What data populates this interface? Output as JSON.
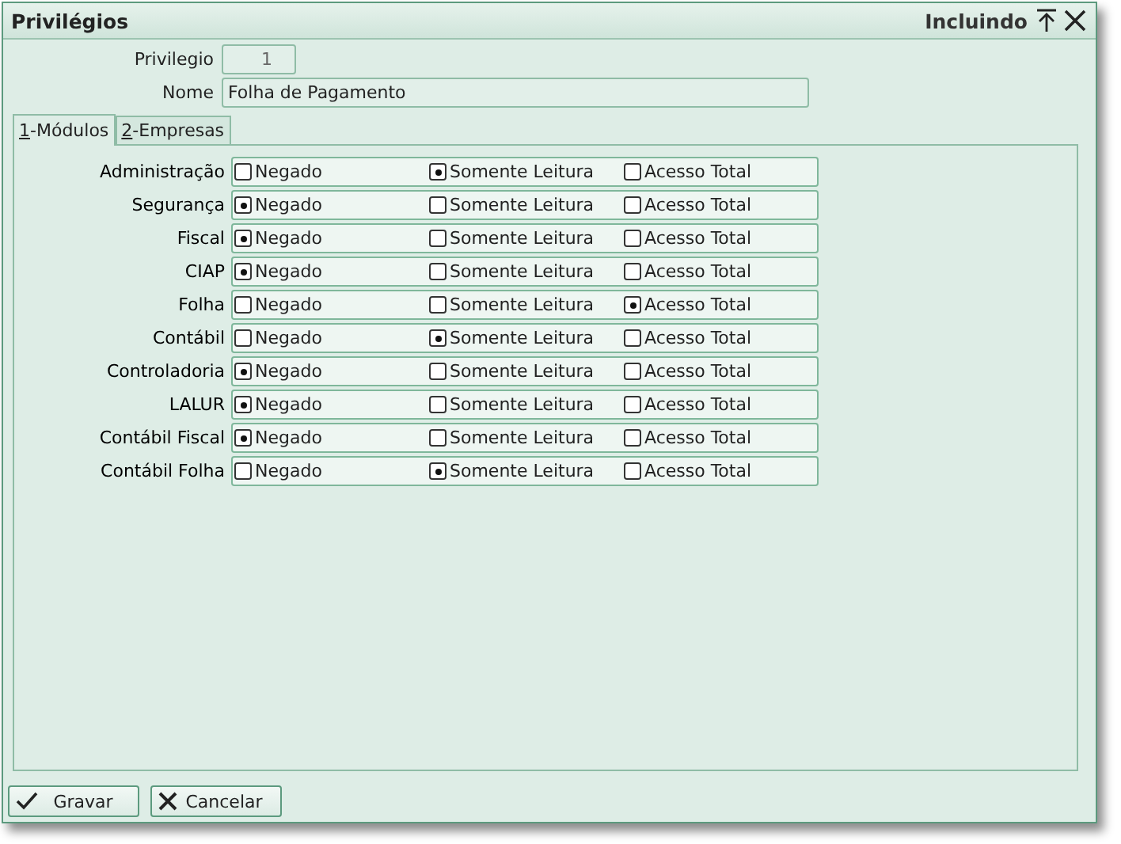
{
  "window": {
    "title": "Privilégios",
    "mode": "Incluindo"
  },
  "fields": [
    {
      "label": "Privilegio",
      "value": "1",
      "kind": "number"
    },
    {
      "label": "Nome",
      "value": "Folha de Pagamento",
      "kind": "text"
    }
  ],
  "tabs": [
    {
      "key": "1",
      "label": "-Módulos",
      "selected": true
    },
    {
      "key": "2",
      "label": "-Empresas",
      "selected": false
    }
  ],
  "modules": [
    {
      "name": "Administração",
      "options": [
        {
          "label": "Negado",
          "selected": false
        },
        {
          "label": "Somente Leitura",
          "selected": true
        },
        {
          "label": "Acesso Total",
          "selected": false
        }
      ]
    },
    {
      "name": "Segurança",
      "options": [
        {
          "label": "Negado",
          "selected": true
        },
        {
          "label": "Somente Leitura",
          "selected": false
        },
        {
          "label": "Acesso Total",
          "selected": false
        }
      ]
    },
    {
      "name": "Fiscal",
      "options": [
        {
          "label": "Negado",
          "selected": true
        },
        {
          "label": "Somente Leitura",
          "selected": false
        },
        {
          "label": "Acesso Total",
          "selected": false
        }
      ]
    },
    {
      "name": "CIAP",
      "options": [
        {
          "label": "Negado",
          "selected": true
        },
        {
          "label": "Somente Leitura",
          "selected": false
        },
        {
          "label": "Acesso Total",
          "selected": false
        }
      ]
    },
    {
      "name": "Folha",
      "options": [
        {
          "label": "Negado",
          "selected": false
        },
        {
          "label": "Somente Leitura",
          "selected": false
        },
        {
          "label": "Acesso Total",
          "selected": true
        }
      ]
    },
    {
      "name": "Contábil",
      "options": [
        {
          "label": "Negado",
          "selected": false
        },
        {
          "label": "Somente Leitura",
          "selected": true
        },
        {
          "label": "Acesso Total",
          "selected": false
        }
      ]
    },
    {
      "name": "Controladoria",
      "options": [
        {
          "label": "Negado",
          "selected": true
        },
        {
          "label": "Somente Leitura",
          "selected": false
        },
        {
          "label": "Acesso Total",
          "selected": false
        }
      ]
    },
    {
      "name": "LALUR",
      "options": [
        {
          "label": "Negado",
          "selected": true
        },
        {
          "label": "Somente Leitura",
          "selected": false
        },
        {
          "label": "Acesso Total",
          "selected": false
        }
      ]
    },
    {
      "name": "Contábil Fiscal",
      "options": [
        {
          "label": "Negado",
          "selected": true
        },
        {
          "label": "Somente Leitura",
          "selected": false
        },
        {
          "label": "Acesso Total",
          "selected": false
        }
      ]
    },
    {
      "name": "Contábil Folha",
      "options": [
        {
          "label": "Negado",
          "selected": false
        },
        {
          "label": "Somente Leitura",
          "selected": true
        },
        {
          "label": "Acesso Total",
          "selected": false
        }
      ]
    }
  ],
  "buttons": [
    {
      "label": "Gravar",
      "kind": "save"
    },
    {
      "label": "Cancelar",
      "kind": "cancel"
    }
  ]
}
